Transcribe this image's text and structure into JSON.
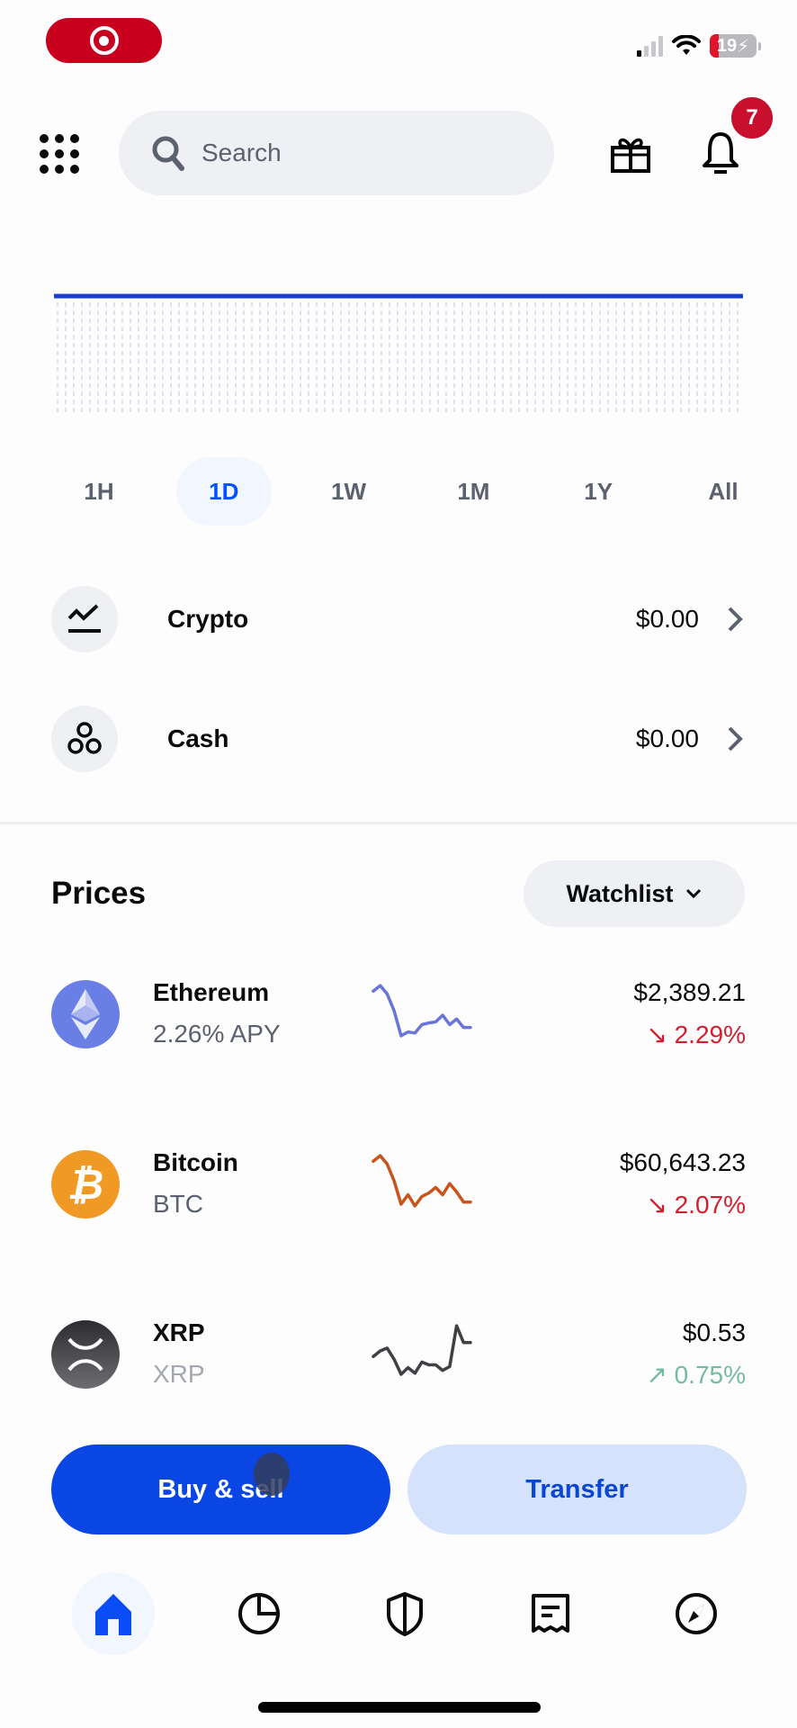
{
  "status_bar": {
    "battery_level": "19",
    "battery_percent": 19,
    "charging": true
  },
  "header": {
    "search_placeholder": "Search",
    "notification_count": "7",
    "icons": [
      "apps-grid-icon",
      "search-icon",
      "gift-icon",
      "bell-icon"
    ]
  },
  "chart": {
    "line_color": "#1a3fcf",
    "state": "flat"
  },
  "ranges": {
    "items": [
      "1H",
      "1D",
      "1W",
      "1M",
      "1Y",
      "All"
    ],
    "selected": "1D"
  },
  "balances": [
    {
      "label": "Crypto",
      "value": "$0.00",
      "icon": "chart-line-icon"
    },
    {
      "label": "Cash",
      "value": "$0.00",
      "icon": "coins-icon"
    }
  ],
  "prices": {
    "title": "Prices",
    "filter_label": "Watchlist",
    "assets": [
      {
        "name": "Ethereum",
        "sub": "2.26% APY",
        "price": "$2,389.21",
        "change": "2.29%",
        "direction": "down",
        "color": "#6a75d8",
        "spark": [
          0.85,
          0.95,
          0.8,
          0.5,
          0.05,
          0.12,
          0.1,
          0.25,
          0.28,
          0.3,
          0.42,
          0.25,
          0.35,
          0.2,
          0.2
        ]
      },
      {
        "name": "Bitcoin",
        "sub": "BTC",
        "price": "$60,643.23",
        "change": "2.07%",
        "direction": "down",
        "color": "#c8531c",
        "spark": [
          0.85,
          0.95,
          0.8,
          0.5,
          0.08,
          0.25,
          0.05,
          0.22,
          0.28,
          0.38,
          0.25,
          0.45,
          0.3,
          0.12,
          0.12
        ]
      },
      {
        "name": "XRP",
        "sub": "XRP",
        "price": "$0.53",
        "change": "0.75%",
        "direction": "up",
        "color": "#3f3f44",
        "spark": [
          0.4,
          0.5,
          0.55,
          0.35,
          0.08,
          0.2,
          0.1,
          0.3,
          0.25,
          0.25,
          0.15,
          0.22,
          0.95,
          0.65,
          0.65
        ]
      }
    ]
  },
  "actions": {
    "primary_label": "Buy & sell",
    "secondary_label": "Transfer"
  },
  "nav": {
    "items": [
      "home",
      "portfolio",
      "security",
      "transactions",
      "explore"
    ],
    "active": "home"
  },
  "colors": {
    "brand_blue": "#0a46e4",
    "down_red": "#cf202f",
    "up_green": "#098551",
    "badge_red": "#c8102e"
  }
}
